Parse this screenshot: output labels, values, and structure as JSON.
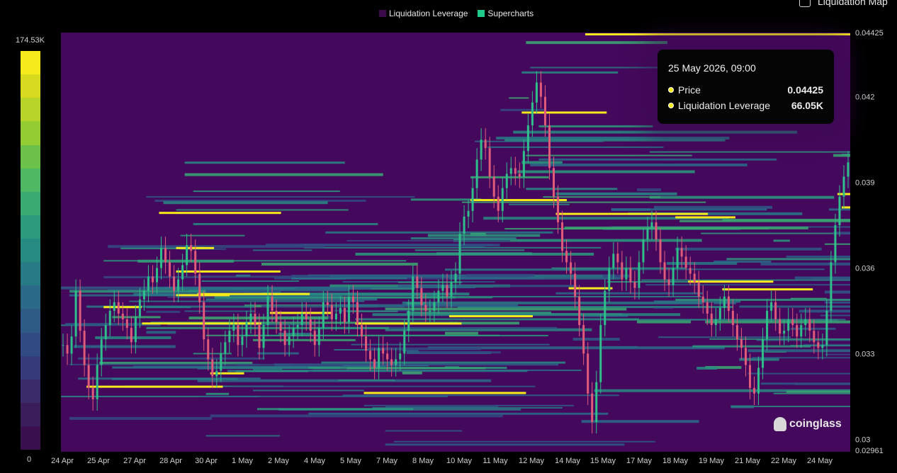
{
  "legend": [
    {
      "label": "Liquidation Leverage",
      "color": "#3a0a4c"
    },
    {
      "label": "Supercharts",
      "color": "#1ec98a"
    }
  ],
  "toggle": {
    "label": "Liquidation Map"
  },
  "colorbar": {
    "max_label": "174.53K",
    "min_label": "0",
    "colors": [
      "#f4ea1c",
      "#d8da20",
      "#b8d42a",
      "#94cc34",
      "#6cc14a",
      "#4eb862",
      "#3aaa72",
      "#2c9a7c",
      "#288b82",
      "#287a86",
      "#2a6a88",
      "#2e5a86",
      "#324a82",
      "#363a78",
      "#3a2c6a",
      "#3b1d5c",
      "#3a0f4e"
    ]
  },
  "tooltip": {
    "date": "25 May 2026, 09:00",
    "rows": [
      {
        "label": "Price",
        "value": "0.04425"
      },
      {
        "label": "Liquidation Leverage",
        "value": "66.05K"
      }
    ]
  },
  "watermark": "coinglass",
  "chart_data": {
    "type": "heatmap",
    "x_ticks": [
      "24 Apr",
      "25 Apr",
      "27 Apr",
      "28 Apr",
      "30 Apr",
      "1 May",
      "2 May",
      "4 May",
      "5 May",
      "7 May",
      "8 May",
      "10 May",
      "11 May",
      "12 May",
      "14 May",
      "15 May",
      "17 May",
      "18 May",
      "19 May",
      "21 May",
      "22 May",
      "24 May"
    ],
    "y_ticks": [
      "0.04425",
      "0.042",
      "0.039",
      "0.036",
      "0.033",
      "0.03",
      "0.02961"
    ],
    "y_tick_values": [
      0.04425,
      0.042,
      0.039,
      0.036,
      0.033,
      0.03,
      0.02961
    ],
    "ylim": [
      0.02961,
      0.04425
    ],
    "background_color": "#44095c",
    "price_line_color": "#e05a7a",
    "price": [
      0.0333,
      0.033,
      0.0336,
      0.0352,
      0.0338,
      0.0326,
      0.0318,
      0.0314,
      0.0326,
      0.0335,
      0.034,
      0.0345,
      0.0348,
      0.0344,
      0.0342,
      0.0339,
      0.0334,
      0.0343,
      0.0349,
      0.0352,
      0.0357,
      0.0355,
      0.036,
      0.0367,
      0.0362,
      0.0357,
      0.0352,
      0.0356,
      0.0361,
      0.0368,
      0.0366,
      0.0358,
      0.0348,
      0.0335,
      0.0328,
      0.0322,
      0.0324,
      0.033,
      0.0334,
      0.0338,
      0.034,
      0.0333,
      0.0336,
      0.0341,
      0.0344,
      0.034,
      0.0332,
      0.034,
      0.035,
      0.0345,
      0.0341,
      0.0338,
      0.0333,
      0.0336,
      0.0339,
      0.034,
      0.0344,
      0.0342,
      0.0338,
      0.0333,
      0.0339,
      0.0348,
      0.0347,
      0.0342,
      0.0344,
      0.0346,
      0.0341,
      0.035,
      0.0348,
      0.034,
      0.0336,
      0.0331,
      0.0328,
      0.0325,
      0.0332,
      0.033,
      0.0328,
      0.0326,
      0.0328,
      0.033,
      0.0338,
      0.0345,
      0.0357,
      0.0353,
      0.0347,
      0.0345,
      0.0345,
      0.0348,
      0.0352,
      0.0354,
      0.035,
      0.0355,
      0.0358,
      0.0372,
      0.0378,
      0.038,
      0.0388,
      0.0398,
      0.0405,
      0.0402,
      0.0392,
      0.0385,
      0.038,
      0.0388,
      0.0393,
      0.0395,
      0.0393,
      0.0392,
      0.0401,
      0.041,
      0.0418,
      0.0425,
      0.042,
      0.041,
      0.0395,
      0.0385,
      0.0376,
      0.0366,
      0.0362,
      0.0358,
      0.035,
      0.034,
      0.033,
      0.0316,
      0.0306,
      0.032,
      0.034,
      0.0352,
      0.036,
      0.0365,
      0.0362,
      0.0356,
      0.036,
      0.0355,
      0.0353,
      0.0362,
      0.037,
      0.0374,
      0.0376,
      0.037,
      0.0362,
      0.0356,
      0.0354,
      0.036,
      0.0367,
      0.0364,
      0.036,
      0.0358,
      0.0355,
      0.035,
      0.0348,
      0.0344,
      0.034,
      0.0342,
      0.0346,
      0.035,
      0.0345,
      0.034,
      0.0335,
      0.0332,
      0.0326,
      0.0318,
      0.0316,
      0.0325,
      0.0335,
      0.0345,
      0.0348,
      0.0342,
      0.0337,
      0.0338,
      0.0342,
      0.034,
      0.0336,
      0.034,
      0.0342,
      0.0338,
      0.0334,
      0.0332,
      0.0333,
      0.0345,
      0.0362,
      0.0375,
      0.0385,
      0.0392,
      0.0397
    ]
  }
}
